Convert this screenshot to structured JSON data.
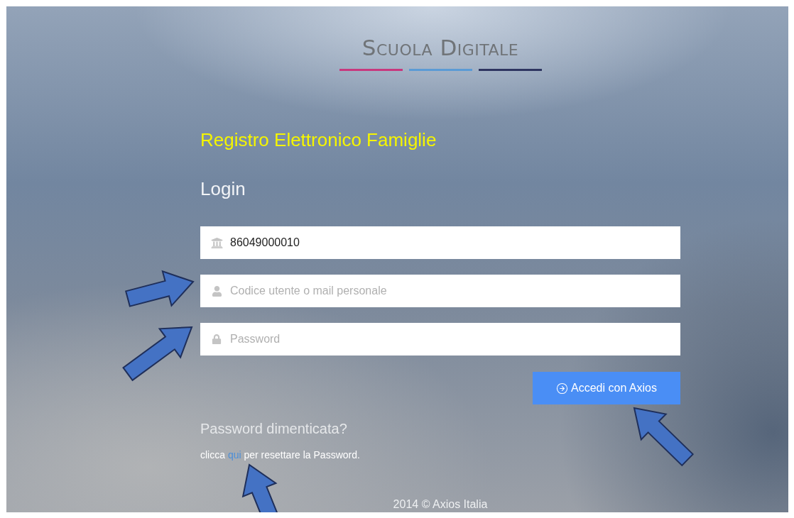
{
  "logo": {
    "text": "Scuola Digitale",
    "stripes": [
      {
        "color": "#c8387e"
      },
      {
        "color": "#5b9bd5"
      },
      {
        "color": "#2e3561"
      }
    ]
  },
  "app_title": "Registro Elettronico Famiglie",
  "heading": "Login",
  "fields": [
    {
      "kind": "school",
      "value": "86049000010"
    },
    {
      "kind": "user",
      "placeholder": "Codice utente o mail personale"
    },
    {
      "kind": "password",
      "placeholder": "Password"
    }
  ],
  "submit": {
    "label": "Accedi con Axios"
  },
  "forgot": {
    "title": "Password dimenticata?",
    "before": "clicca",
    "link": "qui",
    "after": "per resettare la Password."
  },
  "footer": "2014 © Axios Italia"
}
